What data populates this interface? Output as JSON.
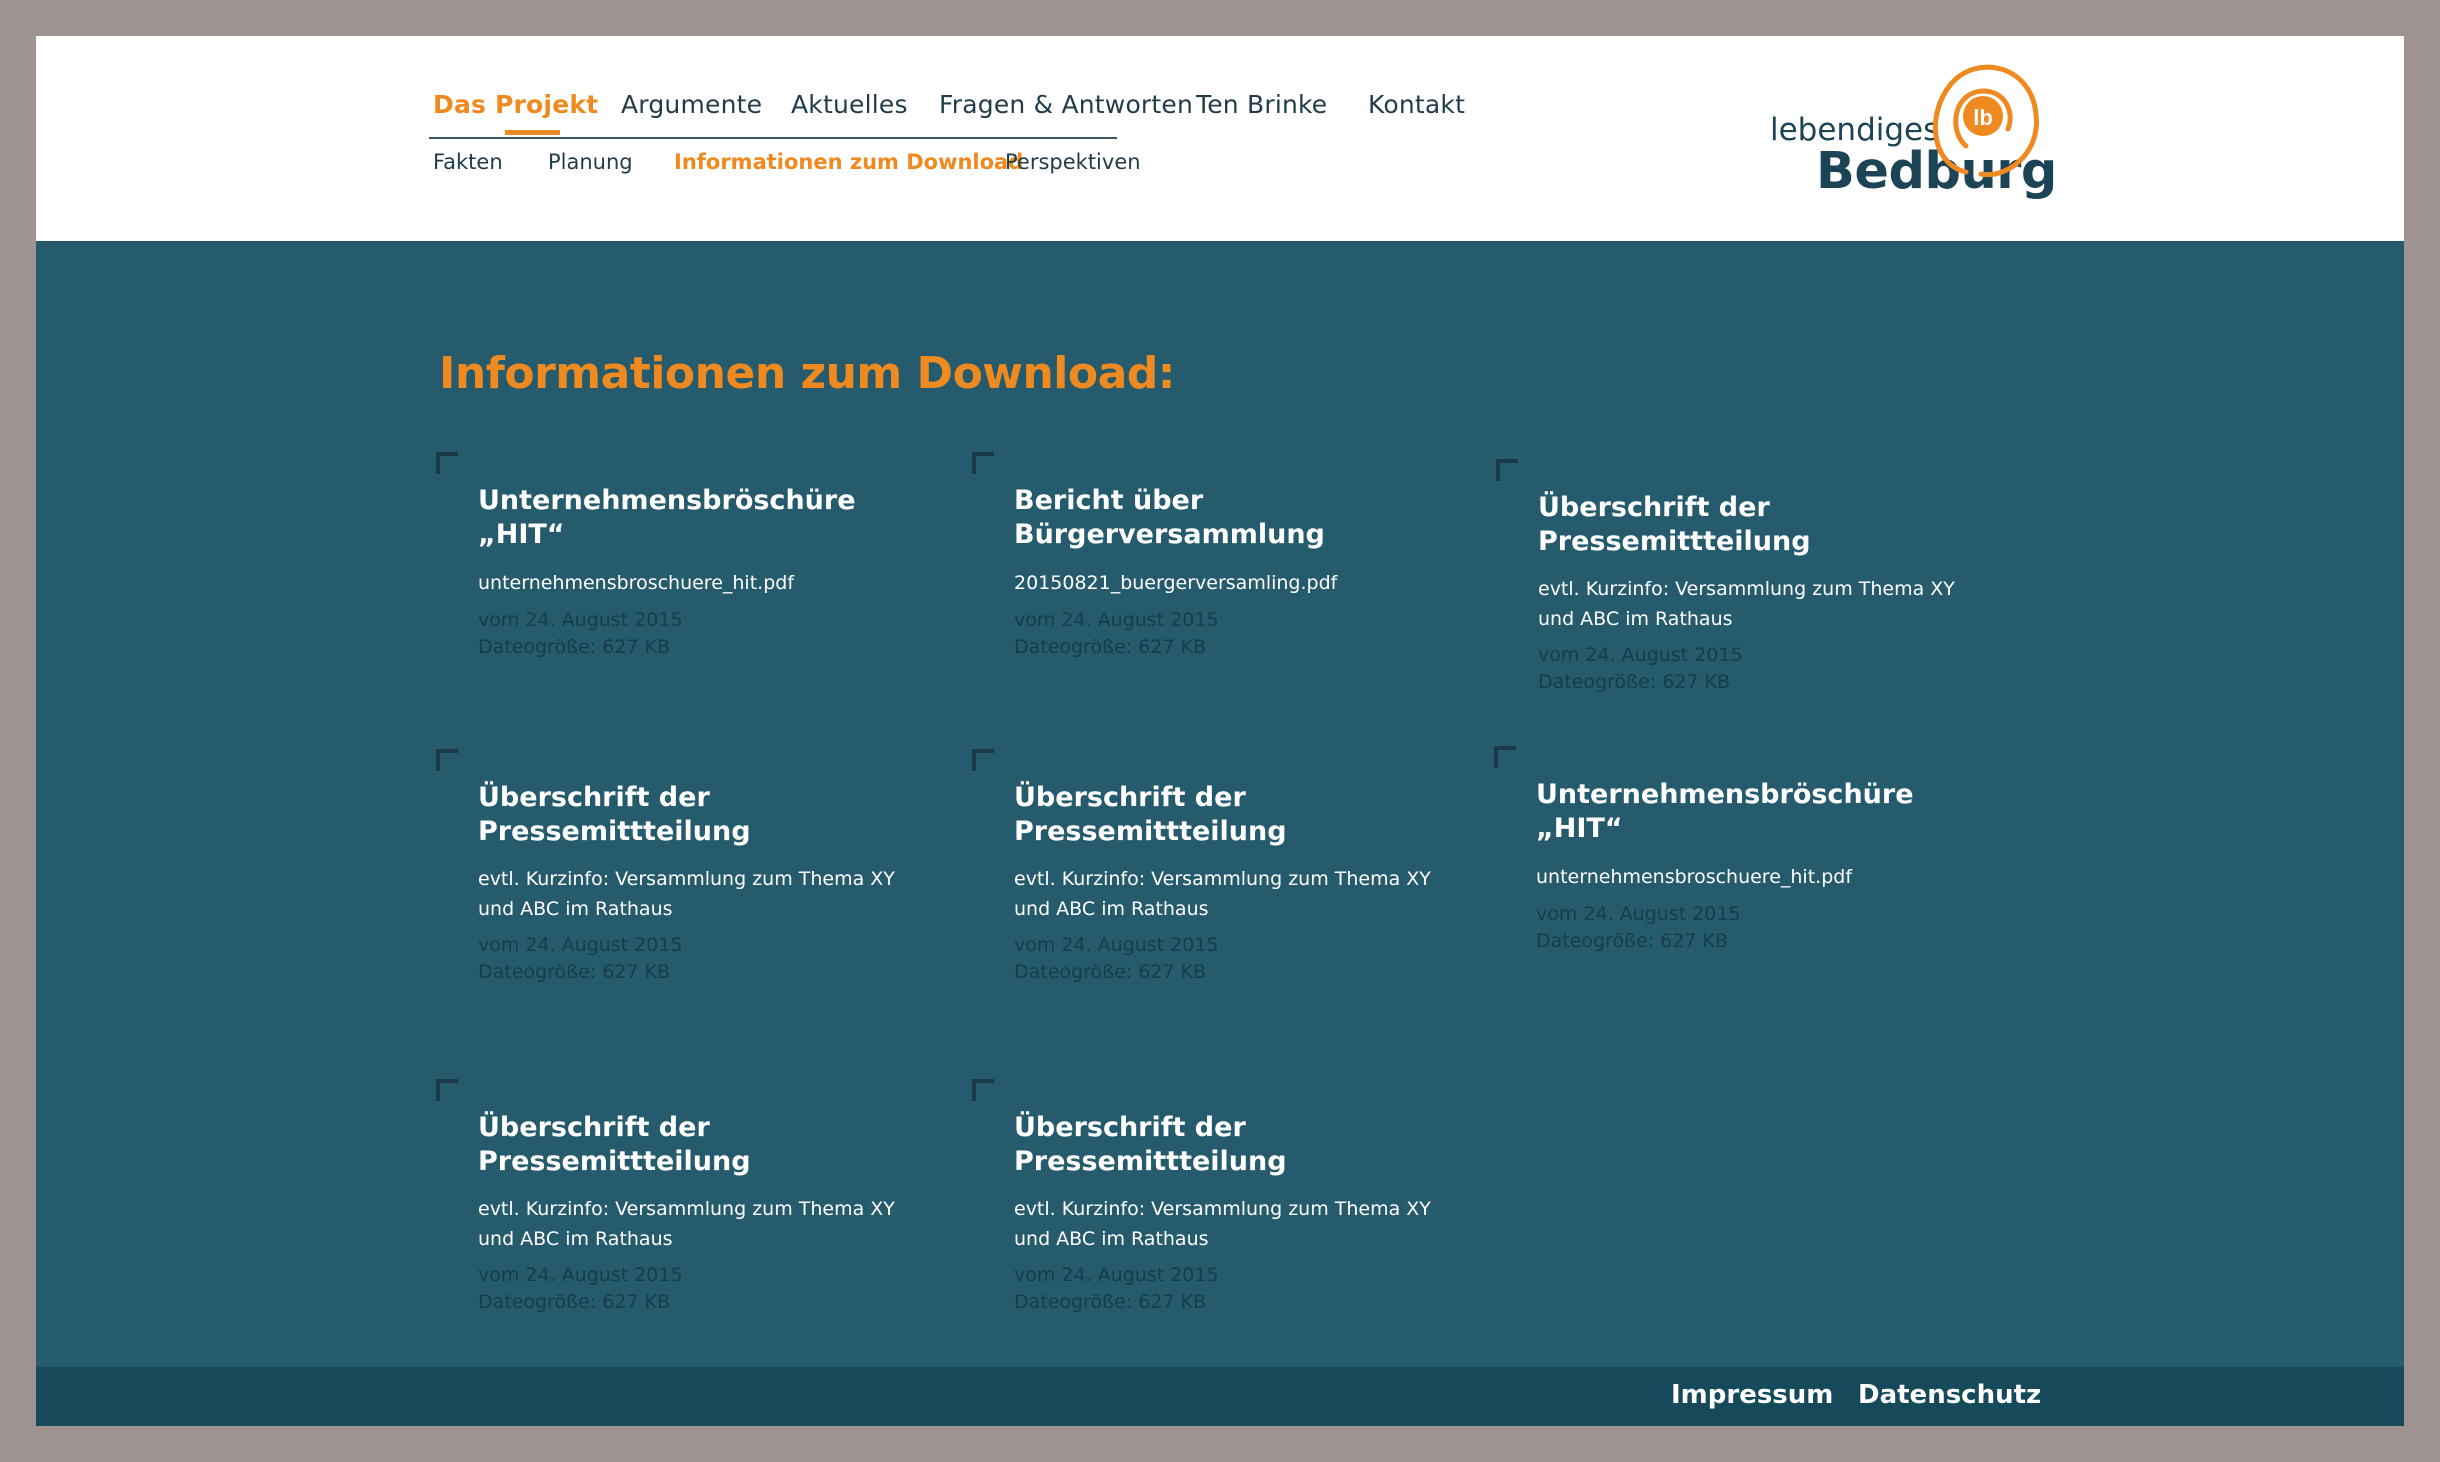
{
  "nav": {
    "primary": [
      {
        "label": "Das Projekt"
      },
      {
        "label": "Argumente"
      },
      {
        "label": "Aktuelles"
      },
      {
        "label": "Fragen & Antworten"
      },
      {
        "label": "Ten Brinke"
      },
      {
        "label": "Kontakt"
      }
    ],
    "primary_active": "Das Projekt",
    "sub": [
      {
        "label": "Fakten"
      },
      {
        "label": "Planung"
      },
      {
        "label": "Informationen zum Download"
      },
      {
        "label": "Perspektiven"
      }
    ],
    "sub_active": "Informationen zum Download"
  },
  "logo": {
    "line1": "lebendiges",
    "line2": "Bedburg",
    "mark": "lb"
  },
  "main": {
    "title": "Informationen zum Download:"
  },
  "downloads": [
    {
      "title": "Unternehmensbröschüre „HIT“",
      "desc": "unternehmensbroschuere_hit.pdf",
      "date": "vom 24. August 2015",
      "size": "Dateogröße: 627 KB"
    },
    {
      "title": "Bericht über Bürgerversammlung",
      "desc": "20150821_buergerversamling.pdf",
      "date": "vom 24. August 2015",
      "size": "Dateogröße: 627 KB"
    },
    {
      "title": "Überschrift der Pressemittteilung",
      "desc": "evtl. Kurzinfo: Versammlung zum Thema XY und ABC im Rathaus",
      "date": "vom 24. August 2015",
      "size": "Dateogröße: 627 KB"
    },
    {
      "title": "Überschrift der Pressemittteilung",
      "desc": "evtl. Kurzinfo: Versammlung zum Thema XY und ABC im Rathaus",
      "date": "vom 24. August 2015",
      "size": "Dateogröße: 627 KB"
    },
    {
      "title": "Überschrift der Pressemittteilung",
      "desc": "evtl. Kurzinfo: Versammlung zum Thema XY und ABC im Rathaus",
      "date": "vom 24. August 2015",
      "size": "Dateogröße: 627 KB"
    },
    {
      "title": "Unternehmensbröschüre „HIT“",
      "desc": "unternehmensbroschuere_hit.pdf",
      "date": "vom 24. August 2015",
      "size": "Dateogröße: 627 KB"
    },
    {
      "title": "Überschrift der Pressemittteilung",
      "desc": "evtl. Kurzinfo: Versammlung zum Thema XY und ABC im Rathaus",
      "date": "vom 24. August 2015",
      "size": "Dateogröße: 627 KB"
    },
    {
      "title": "Überschrift der Pressemittteilung",
      "desc": "evtl. Kurzinfo: Versammlung zum Thema XY und ABC im Rathaus",
      "date": "vom 24. August 2015",
      "size": "Dateogröße: 627 KB"
    }
  ],
  "footer": {
    "links": [
      {
        "label": "Impressum"
      },
      {
        "label": "Datenschutz"
      }
    ]
  },
  "colors": {
    "accent": "#ee8a1f",
    "main_bg": "#255b6c",
    "footer_bg": "#164a5b",
    "nav_text": "#1f3c48"
  }
}
